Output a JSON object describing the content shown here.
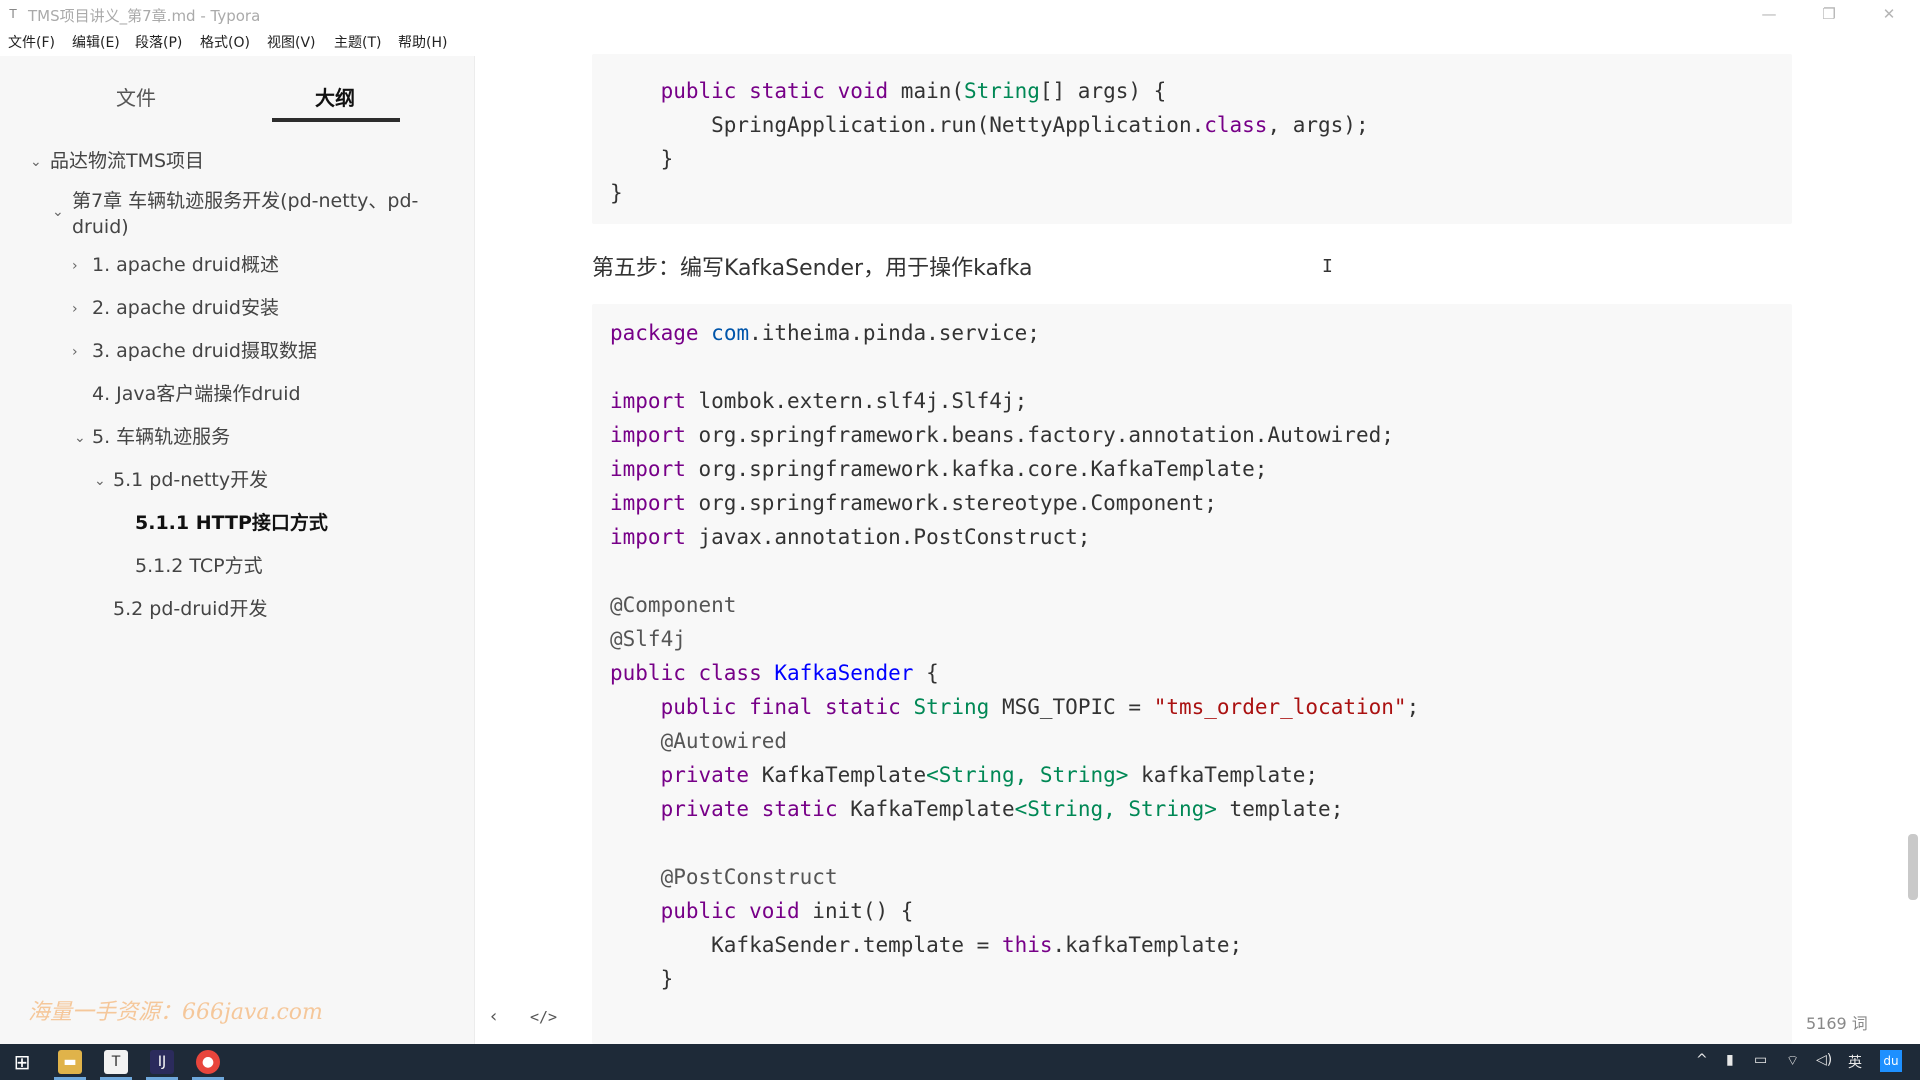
{
  "window": {
    "title": "TMS项目讲义_第7章.md - Typora",
    "controls": {
      "minimize": "—",
      "maximize": "❐",
      "close": "✕"
    }
  },
  "menu": [
    "文件(F)",
    "编辑(E)",
    "段落(P)",
    "格式(O)",
    "视图(V)",
    "主题(T)",
    "帮助(H)"
  ],
  "sidebar": {
    "tabs": [
      "文件",
      "大纲"
    ],
    "active_tab": "大纲",
    "outline": [
      {
        "label": "品达物流TMS项目",
        "expanded": true
      },
      {
        "label": "第7章 车辆轨迹服务开发(pd-netty、pd-",
        "expanded": true
      },
      {
        "label": "druid)"
      },
      {
        "label": "1. apache druid概述",
        "expanded": false
      },
      {
        "label": "2. apache druid安装",
        "expanded": false
      },
      {
        "label": "3. apache druid摄取数据",
        "expanded": false
      },
      {
        "label": "4. Java客户端操作druid"
      },
      {
        "label": "5. 车辆轨迹服务",
        "expanded": true
      },
      {
        "label": "5.1 pd-netty开发",
        "expanded": true
      },
      {
        "label": "5.1.1 HTTP接口方式",
        "active": true
      },
      {
        "label": "5.1.2 TCP方式"
      },
      {
        "label": "5.2 pd-druid开发"
      }
    ],
    "watermark": "海量一手资源：666java.com",
    "back_icon": "‹",
    "source_icon": "</>"
  },
  "editor": {
    "step_heading": "第五步：编写KafkaSender，用于操作kafka",
    "word_count": "5169 词",
    "code_top": [
      "    public static void main(String[] args) {",
      "        SpringApplication.run(NettyApplication.class, args);",
      "    }",
      "}"
    ],
    "code_main": [
      "package com.itheima.pinda.service;",
      "",
      "import lombok.extern.slf4j.Slf4j;",
      "import org.springframework.beans.factory.annotation.Autowired;",
      "import org.springframework.kafka.core.KafkaTemplate;",
      "import org.springframework.stereotype.Component;",
      "import javax.annotation.PostConstruct;",
      "",
      "@Component",
      "@Slf4j",
      "public class KafkaSender {",
      "    public final static String MSG_TOPIC = \"tms_order_location\";",
      "    @Autowired",
      "    private KafkaTemplate<String, String> kafkaTemplate;",
      "    private static KafkaTemplate<String, String> template;",
      "",
      "    @PostConstruct",
      "    public void init() {",
      "        KafkaSender.template = this.kafkaTemplate;",
      "    }"
    ]
  },
  "taskbar": {
    "apps": [
      "windows-start-icon",
      "file-explorer-icon",
      "typora-icon",
      "intellij-icon",
      "chrome-icon"
    ],
    "tray": [
      "^",
      "🎤",
      "▭",
      "⌔",
      "🔈",
      "英"
    ],
    "badge": "du"
  }
}
